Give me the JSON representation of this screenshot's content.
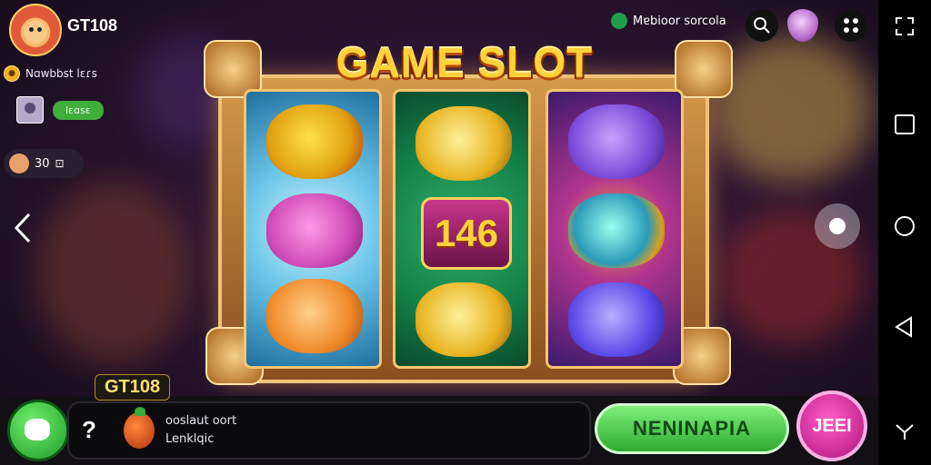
{
  "header": {
    "brand": "GT108",
    "row1_text": "Nɑwbbst lɛɾs",
    "pill_label": "lɛɑsɛ",
    "chip_text": "30",
    "status_text": "Mɐbioor sorcola"
  },
  "game": {
    "title": "GAME SLOT",
    "center_number": "146",
    "symbols": {
      "reel1": [
        "parrot-icon",
        "croc-icon",
        "orange-icon"
      ],
      "reel2": [
        "coins-icon",
        "number-146",
        "key-coin-icon"
      ],
      "reel3": [
        "panther-icon",
        "gem-icon",
        "eggplant-icon"
      ]
    }
  },
  "bottom": {
    "badge": "GT108",
    "message_line1": "ooslaut oort",
    "message_line2": "Lenklqic",
    "spin_label": "NENINAPIA",
    "bet_label": "JEEI"
  },
  "colors": {
    "accent_gold": "#ffd23a",
    "spin_green": "#2eaa30",
    "bet_pink": "#b0127a"
  }
}
